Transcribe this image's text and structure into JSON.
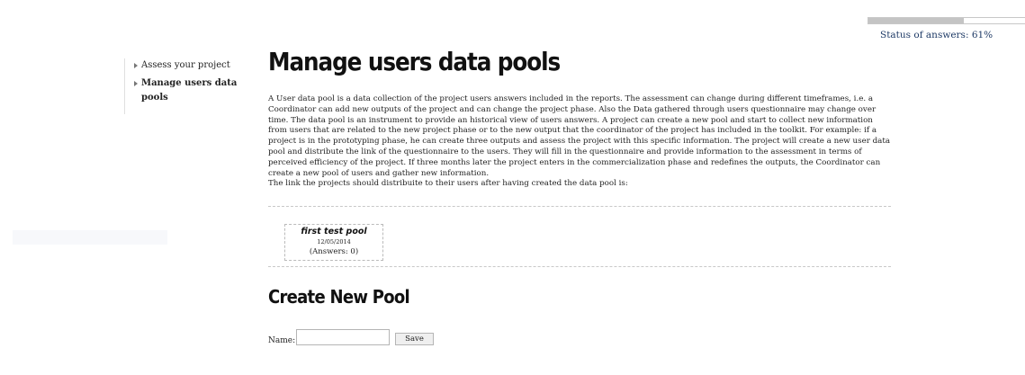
{
  "status": {
    "label": "Status of answers: 61%",
    "progress_percent": 61
  },
  "sidebar": {
    "items": [
      {
        "label": "Assess your project",
        "active": false,
        "icon": "triangle-right-icon"
      },
      {
        "label": "Manage users data pools",
        "active": true,
        "icon": "triangle-right-icon"
      }
    ]
  },
  "main": {
    "title": "Manage users data pools",
    "description": [
      "A User data pool is a data collection of the project users answers included in the reports. The assessment can change during different timeframes, i.e. a Coordinator can add new outputs of the project and can change the project phase. Also the Data gathered through users questionnaire may change over time. The data pool is an instrument to provide an historical view of users answers. A project can create a new pool and start to collect new information from users that are related to the new project phase or to the new output that the coordinator of the project has included in the toolkit. For example: if a project is in the prototyping phase, he can create three outputs and assess the project with this specific information. The project will create a new user data pool and distribute the link of the questionnaire to the users. They will fill in the questionnaire and provide information to the assessment in terms of perceived efficiency of the project. If three months later the project enters in the commercialization phase and redefines the outputs, the Coordinator can create a new pool of users and gather new information.",
      "The link the projects should distribuite to their users after having created the data pool is:"
    ],
    "pools": [
      {
        "name": "first test pool",
        "date": "12/05/2014",
        "answers": "(Answers: 0)"
      }
    ]
  },
  "create_pool": {
    "title": "Create New Pool",
    "name_label": "Name:",
    "name_value": "",
    "save_label": "Save"
  }
}
